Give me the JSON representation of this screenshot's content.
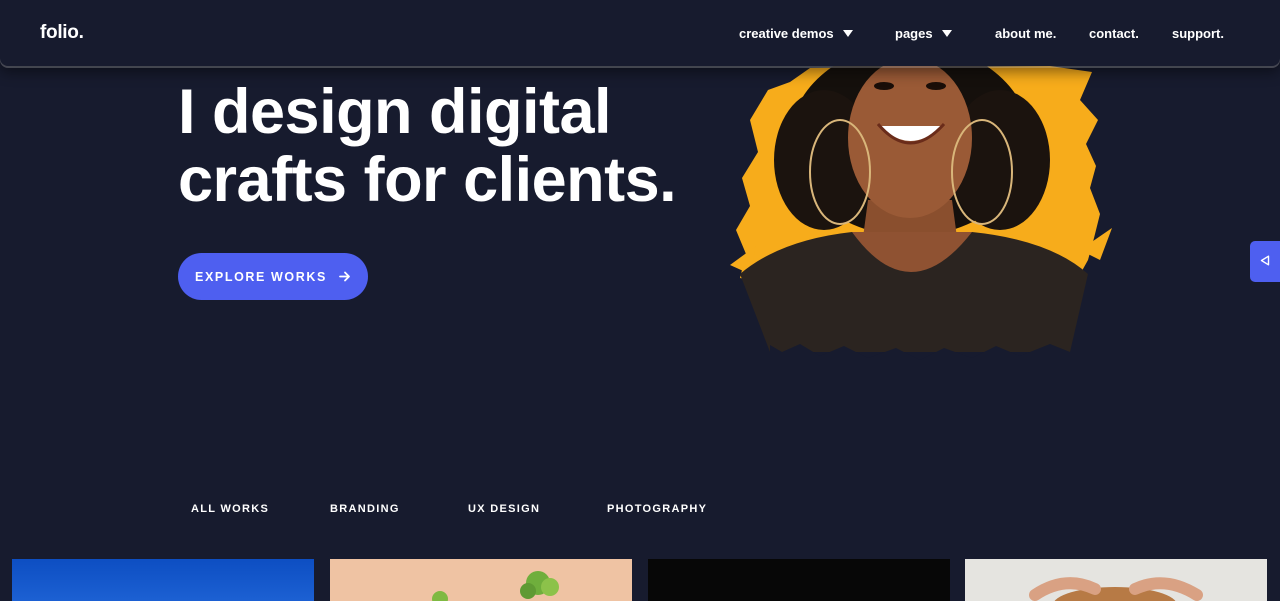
{
  "brand": {
    "logo": "folio."
  },
  "nav": {
    "items": [
      {
        "label": "creative demos",
        "has_dropdown": true
      },
      {
        "label": "pages",
        "has_dropdown": true
      },
      {
        "label": "about me.",
        "has_dropdown": false
      },
      {
        "label": "contact.",
        "has_dropdown": false
      },
      {
        "label": "support.",
        "has_dropdown": false
      }
    ]
  },
  "hero": {
    "title_line_1": "I design digital",
    "title_line_2": "crafts for clients.",
    "cta_label": "EXPLORE WORKS",
    "cta_icon": "arrow-right-icon",
    "image": "smiling-woman-portrait"
  },
  "side_toggle": {
    "icon": "triangle-left-icon"
  },
  "filters": [
    "ALL WORKS",
    "BRANDING",
    "UX DESIGN",
    "PHOTOGRAPHY"
  ],
  "portfolio": [
    {
      "name": "blue-project-thumbnail"
    },
    {
      "name": "plant-project-thumbnail"
    },
    {
      "name": "dark-project-thumbnail"
    },
    {
      "name": "bread-project-thumbnail"
    }
  ],
  "colors": {
    "background": "#171b2e",
    "accent": "#4e5ff0",
    "paint_splash": "#f7ac1b",
    "text": "#ffffff"
  }
}
